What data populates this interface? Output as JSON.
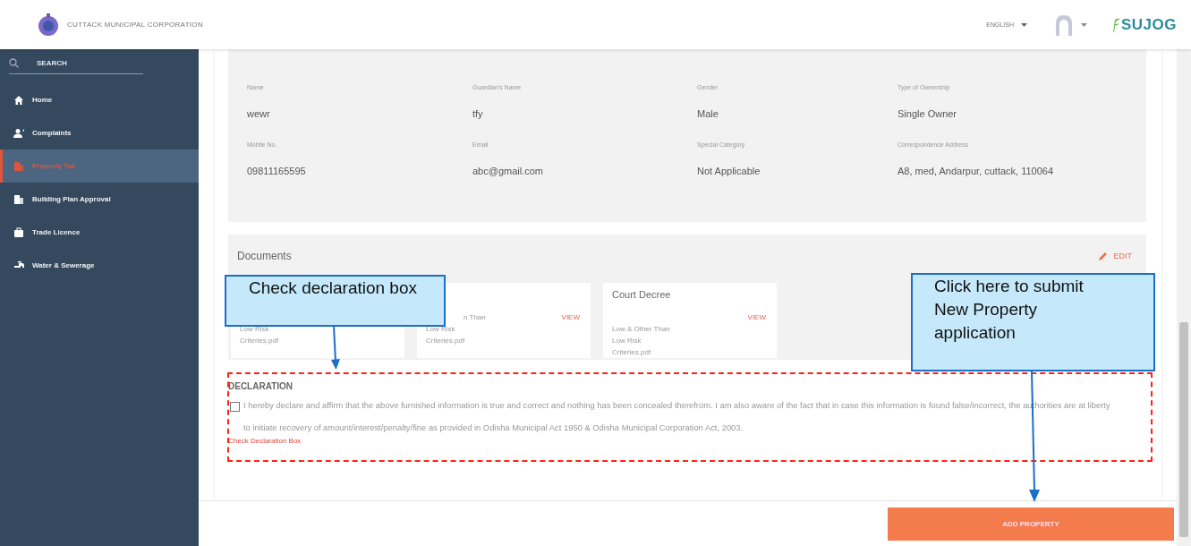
{
  "header": {
    "org_name": "CUTTACK MUNICIPAL CORPORATION",
    "language": "ENGLISH",
    "brand": "SUJOG"
  },
  "sidebar": {
    "search": {
      "placeholder": "SEARCH"
    },
    "items": [
      {
        "label": "Home",
        "selected": false
      },
      {
        "label": "Complaints",
        "selected": false
      },
      {
        "label": "Property Tax",
        "selected": true
      },
      {
        "label": "Building Plan Approval",
        "selected": false
      },
      {
        "label": "Trade Licence",
        "selected": false
      },
      {
        "label": "Water & Sewerage",
        "selected": false
      }
    ]
  },
  "owner_details": {
    "fields": [
      {
        "label": "Name",
        "value": "wewr"
      },
      {
        "label": "Guardian's Name",
        "value": "tfy"
      },
      {
        "label": "Gender",
        "value": "Male"
      },
      {
        "label": "Type of Ownership",
        "value": "Single Owner"
      },
      {
        "label": "Mobile No.",
        "value": "09811165595"
      },
      {
        "label": "Email",
        "value": "abc@gmail.com"
      },
      {
        "label": "Special Category",
        "value": "Not Applicable"
      },
      {
        "label": "Correspondence Address",
        "value": "A8, med, Andarpur, cuttack, 110064"
      }
    ]
  },
  "documents": {
    "title": "Documents",
    "edit_label": "EDIT",
    "cards": [
      {
        "lines": [
          "Low Risk",
          "Criteries.pdf"
        ]
      },
      {
        "partial_line": "n Than",
        "lines": [
          "Low Risk",
          "Criteries.pdf"
        ],
        "view_label": "VIEW"
      },
      {
        "title": "Court Decree",
        "lines": [
          "Low & Other Than",
          "Low Risk",
          "Criteries.pdf"
        ],
        "view_label": "VIEW"
      }
    ]
  },
  "declaration": {
    "title": "DECLARATION",
    "checked": false,
    "text": "I hereby declare and affirm that the above furnished information is true and correct and nothing has been concealed therefrom. I am also aware of the fact that in case this information is found false/incorrect, the authorities are at liberty to initiate recovery of amount/interest/penalty/fine as provided in Odisha Municipal Act 1950 & Odisha Municipal Corporation Act, 2003.",
    "error": "Check Declaration Box"
  },
  "footer": {
    "button": "ADD PROPERTY"
  },
  "annotations": [
    {
      "kind": "checkbox-note",
      "text": "Check declaration box"
    },
    {
      "kind": "submit-note",
      "text": "Click here to submit New Property application"
    }
  ]
}
